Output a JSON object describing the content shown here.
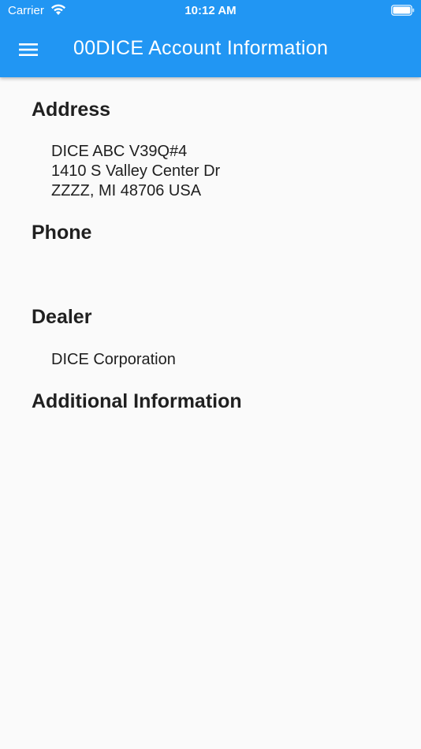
{
  "status_bar": {
    "carrier": "Carrier",
    "time": "10:12 AM",
    "wifi_icon": "wifi-icon",
    "battery_icon": "battery-icon"
  },
  "app_bar": {
    "menu_icon": "menu-icon",
    "title": "00DICE Account Information",
    "background_color": "#2196f3"
  },
  "address": {
    "heading": "Address",
    "lines": [
      "DICE ABC V39Q#4",
      "1410 S Valley Center Dr",
      "ZZZZ, MI 48706 USA"
    ]
  },
  "phone": {
    "heading": "Phone"
  },
  "dealer": {
    "heading": "Dealer",
    "name": "DICE Corporation"
  },
  "additional": {
    "heading": "Additional Information"
  }
}
